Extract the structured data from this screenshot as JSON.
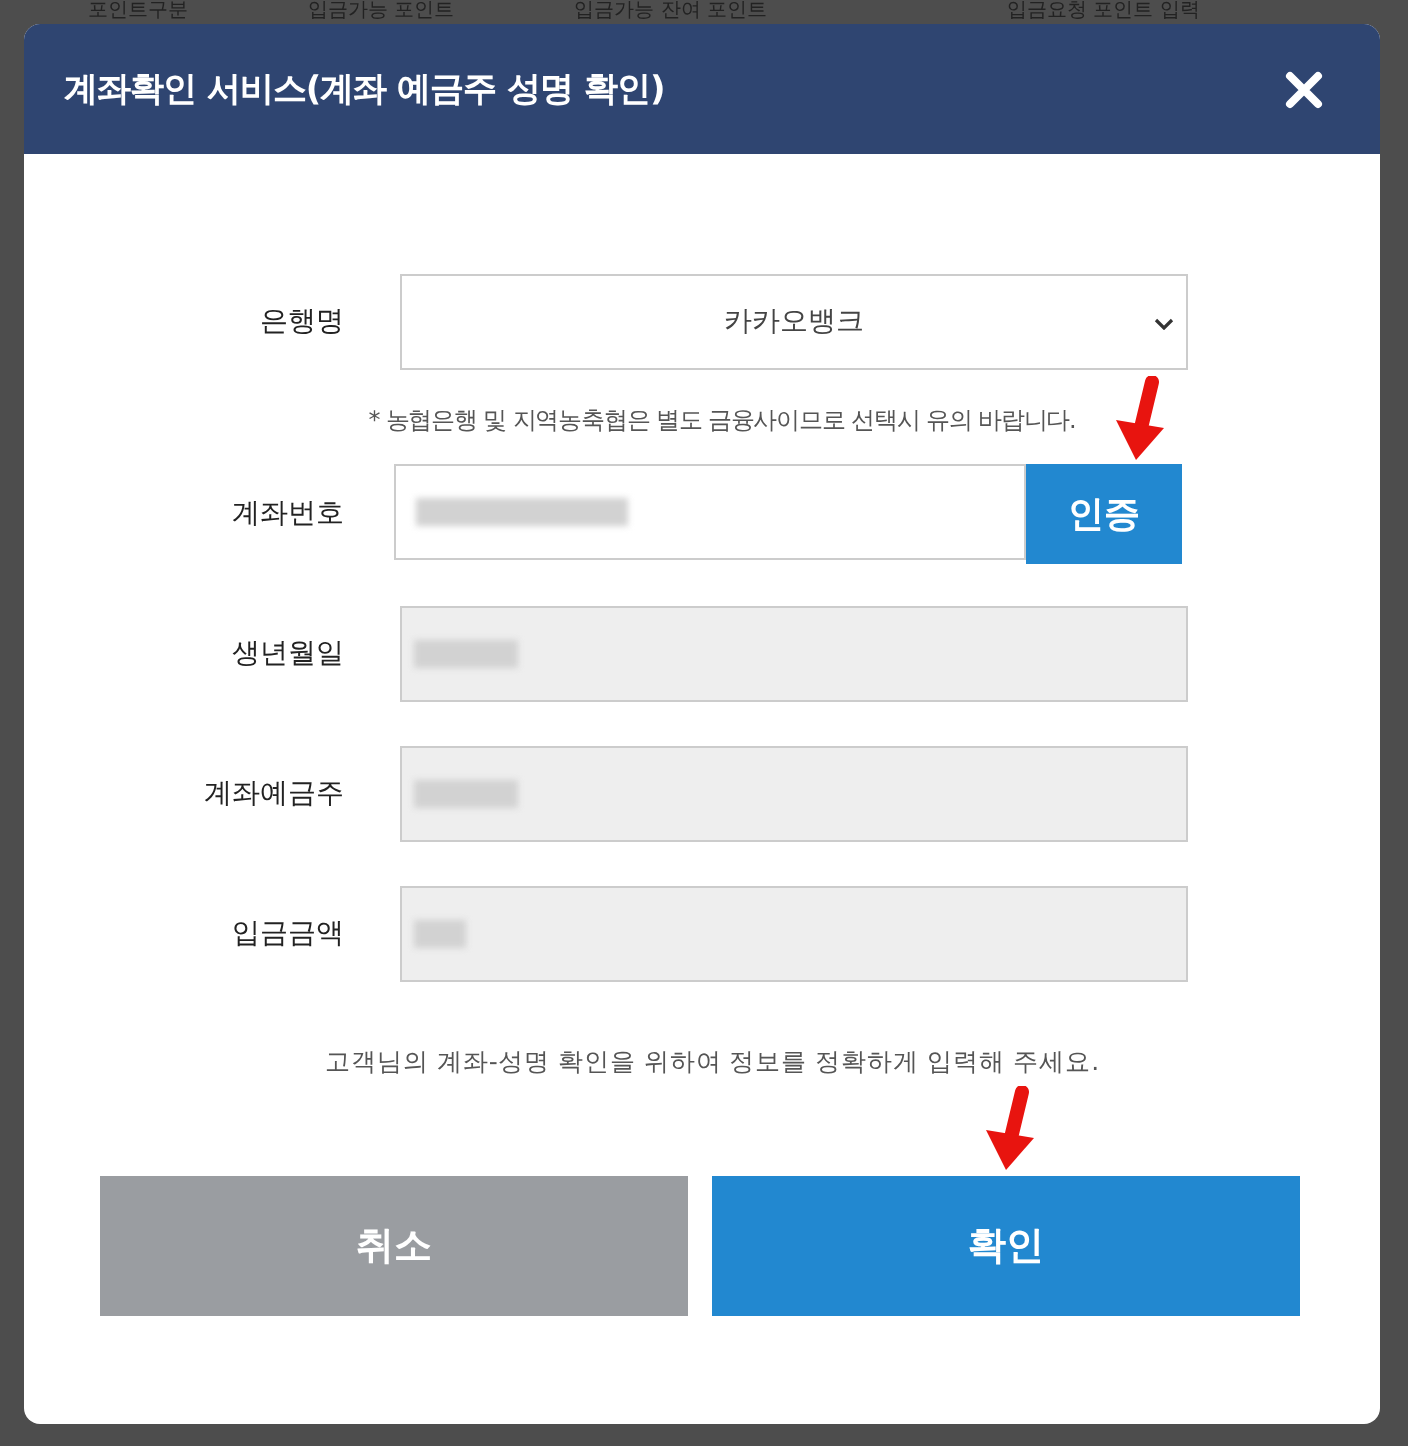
{
  "background_table": {
    "columns": [
      "포인트구분",
      "입금가능 포인트",
      "입금가능 잔여 포인트",
      "입금요청 포인트 입력"
    ]
  },
  "dialog": {
    "title": "계좌확인 서비스(계좌 예금주 성명 확인)",
    "fields": [
      {
        "kind": "select",
        "label": "은행명",
        "value": "카카오뱅크"
      },
      {
        "kind": "notice",
        "text": "* 농협은행 및 지역농축협은 별도 금융사이므로 선택시 유의 바랍니다."
      },
      {
        "kind": "input_with_button",
        "label": "계좌번호",
        "redacted": true,
        "button": {
          "label": "인증",
          "arrow_marked": true
        }
      },
      {
        "kind": "readonly",
        "label": "생년월일",
        "redacted": true
      },
      {
        "kind": "readonly",
        "label": "계좌예금주",
        "redacted": true
      },
      {
        "kind": "readonly",
        "label": "입금금액",
        "redacted": true
      }
    ],
    "footnote": "고객님의 계좌-성명 확인을 위하여 정보를 정확하게 입력해 주세요.",
    "buttons": [
      {
        "kind": "cancel",
        "label": "취소",
        "arrow_marked": false
      },
      {
        "kind": "confirm",
        "label": "확인",
        "arrow_marked": true
      }
    ]
  }
}
